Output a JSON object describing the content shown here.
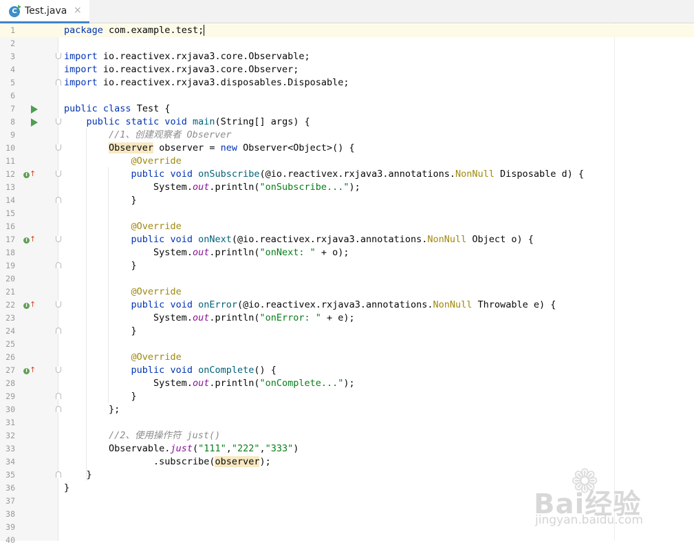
{
  "tab": {
    "title": "Test.java",
    "icon": "java-class-icon",
    "close": "×"
  },
  "colors": {
    "keyword": "#0033b3",
    "string": "#067d17",
    "annotation": "#9e880d",
    "comment": "#8c8c8c",
    "static_field": "#871094",
    "accent": "#4083c9"
  },
  "lines": {
    "n1": "1",
    "n2": "2",
    "n3": "3",
    "n4": "4",
    "n5": "5",
    "n6": "6",
    "n7": "7",
    "n8": "8",
    "n9": "9",
    "n10": "10",
    "n11": "11",
    "n12": "12",
    "n13": "13",
    "n14": "14",
    "n15": "15",
    "n16": "16",
    "n17": "17",
    "n18": "18",
    "n19": "19",
    "n20": "20",
    "n21": "21",
    "n22": "22",
    "n23": "23",
    "n24": "24",
    "n25": "25",
    "n26": "26",
    "n27": "27",
    "n28": "28",
    "n29": "29",
    "n30": "30",
    "n31": "31",
    "n32": "32",
    "n33": "33",
    "n34": "34",
    "n35": "35",
    "n36": "36",
    "n37": "37",
    "n38": "38",
    "n39": "39",
    "n40": "40"
  },
  "code": {
    "kw_package": "package",
    "package_name": " com.example.test;",
    "kw_import": "import",
    "imp1": " io.reactivex.rxjava3.core.Observable;",
    "imp2": " io.reactivex.rxjava3.core.Observer;",
    "imp3": " io.reactivex.rxjava3.disposables.Disposable;",
    "kw_public": "public",
    "kw_class": "class",
    "class_name": " Test {",
    "kw_static": "static",
    "kw_void": "void",
    "main_sig": "main",
    "main_params": "(String[] args) {",
    "comment1": "//1、创建观察者 Observer",
    "type_observer": "Observer",
    "decl_rest": " observer = ",
    "kw_new": "new",
    "new_rest": " Observer<Object>() {",
    "override": "@Override",
    "on_subscribe": "onSubscribe",
    "ann_prefix": "(@io.reactivex.rxjava3.annotations.",
    "nonnull": "NonNull",
    "sub_param": " Disposable d) {",
    "sysout": "System.",
    "out": "out",
    "println": ".println(",
    "str_subscribe": "\"onSubscribe...\"",
    "close_call": ");",
    "brace": "}",
    "on_next": "onNext",
    "next_param": " Object o) {",
    "str_next": "\"onNext: \"",
    "plus_o": " + o);",
    "on_error": "onError",
    "error_param": " Throwable e) {",
    "str_error": "\"onError: \"",
    "plus_e": " + e);",
    "on_complete": "onComplete",
    "complete_param": "() {",
    "str_complete": "\"onComplete...\"",
    "close_anon": "};",
    "comment2": "//2、使用操作符 just()",
    "observable": "Observable.",
    "just": "just",
    "open_paren": "(",
    "s111": "\"111\"",
    "comma": ",",
    "s222": "\"222\"",
    "s333": "\"333\"",
    "close_paren": ")",
    "subscribe_call": ".subscribe(",
    "observer_arg": "observer",
    "subscribe_end": ");"
  },
  "watermark": {
    "brand": "Bai经验",
    "url": "jingyan.baidu.com"
  }
}
